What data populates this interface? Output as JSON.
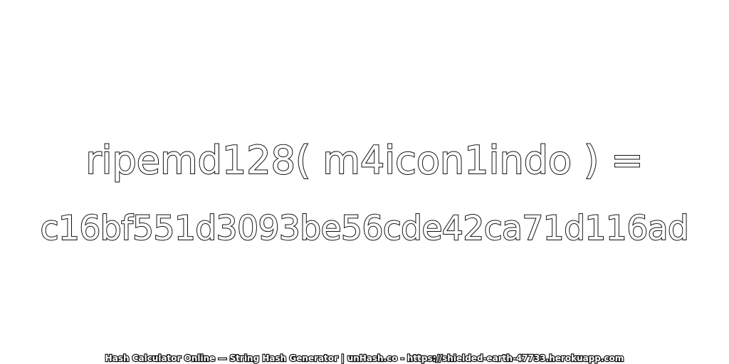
{
  "expression": "ripemd128( m4icon1indo ) =",
  "hash_value": "c16bf551d3093be56cde42ca71d116ad",
  "footer_text": "Hash Calculator Online — String Hash Generator | unHash.co - https://shielded-earth-47733.herokuapp.com",
  "colors": {
    "background": "#ffffff",
    "text_fill": "#ffffff",
    "text_outline": "#111111"
  }
}
